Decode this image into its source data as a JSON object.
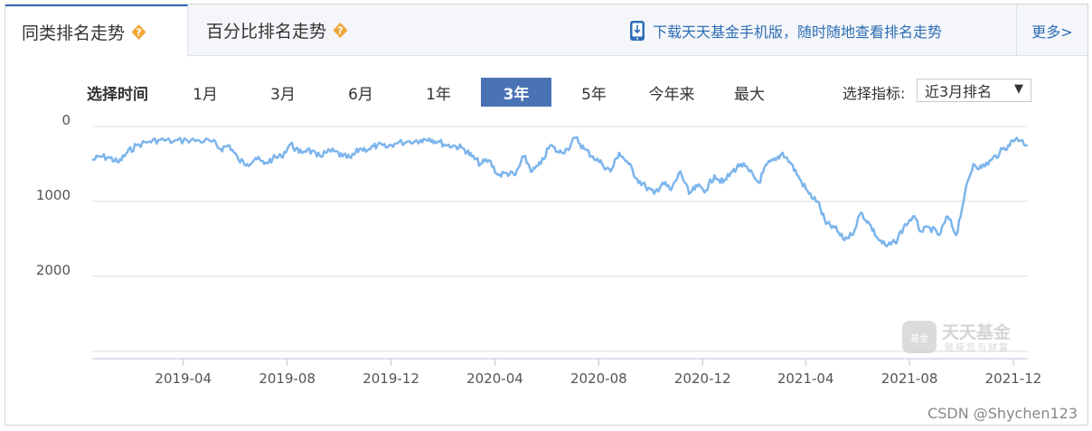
{
  "tabs": [
    {
      "label": "同类排名走势",
      "active": true
    },
    {
      "label": "百分比排名走势",
      "active": false
    }
  ],
  "promo_text": "下载天天基金手机版，随时随地查看排名走势",
  "more_label": "更多>",
  "time_select": {
    "label": "选择时间",
    "options": [
      "1月",
      "3月",
      "6月",
      "1年",
      "3年",
      "5年",
      "今年来",
      "最大"
    ],
    "active": "3年"
  },
  "metric": {
    "label": "选择指标:",
    "selected": "近3月排名"
  },
  "watermark": {
    "name": "天天基金",
    "slogan": "链接您与财富",
    "badge": "基金"
  },
  "credit": "CSDN @Shychen123",
  "colors": {
    "accent": "#4a73b5",
    "line": "#7cb5ec",
    "link": "#2e6db4",
    "icon_orange": "#f0a83a"
  },
  "chart_data": {
    "type": "line",
    "y_reversed": true,
    "ylim": [
      0,
      3100
    ],
    "xlim": [
      "2018-12-15",
      "2021-12-18"
    ],
    "y_ticks": [
      0,
      1000,
      2000
    ],
    "x_ticks": [
      "2019-04",
      "2019-08",
      "2019-12",
      "2020-04",
      "2020-08",
      "2020-12",
      "2021-04",
      "2021-08",
      "2021-12"
    ],
    "grid": true,
    "series": [
      {
        "points": [
          [
            "2018-12-15",
            450
          ],
          [
            "2018-12-25",
            400
          ],
          [
            "2019-01-05",
            420
          ],
          [
            "2019-01-15",
            480
          ],
          [
            "2019-01-25",
            350
          ],
          [
            "2019-02-05",
            250
          ],
          [
            "2019-02-20",
            200
          ],
          [
            "2019-03-05",
            180
          ],
          [
            "2019-03-20",
            200
          ],
          [
            "2019-04-05",
            180
          ],
          [
            "2019-04-20",
            190
          ],
          [
            "2019-05-05",
            200
          ],
          [
            "2019-05-15",
            300
          ],
          [
            "2019-05-25",
            250
          ],
          [
            "2019-06-05",
            450
          ],
          [
            "2019-06-15",
            500
          ],
          [
            "2019-06-25",
            420
          ],
          [
            "2019-07-05",
            500
          ],
          [
            "2019-07-15",
            430
          ],
          [
            "2019-07-25",
            400
          ],
          [
            "2019-08-05",
            230
          ],
          [
            "2019-08-15",
            350
          ],
          [
            "2019-08-25",
            300
          ],
          [
            "2019-09-05",
            400
          ],
          [
            "2019-09-15",
            350
          ],
          [
            "2019-09-25",
            330
          ],
          [
            "2019-10-05",
            400
          ],
          [
            "2019-10-15",
            420
          ],
          [
            "2019-10-25",
            300
          ],
          [
            "2019-11-05",
            300
          ],
          [
            "2019-11-15",
            250
          ],
          [
            "2019-11-25",
            280
          ],
          [
            "2019-12-05",
            230
          ],
          [
            "2019-12-20",
            200
          ],
          [
            "2020-01-05",
            180
          ],
          [
            "2020-01-15",
            160
          ],
          [
            "2020-01-25",
            200
          ],
          [
            "2020-02-05",
            250
          ],
          [
            "2020-02-15",
            260
          ],
          [
            "2020-02-25",
            300
          ],
          [
            "2020-03-05",
            400
          ],
          [
            "2020-03-15",
            500
          ],
          [
            "2020-03-25",
            450
          ],
          [
            "2020-04-05",
            650
          ],
          [
            "2020-04-15",
            620
          ],
          [
            "2020-04-25",
            650
          ],
          [
            "2020-05-05",
            400
          ],
          [
            "2020-05-15",
            600
          ],
          [
            "2020-05-25",
            500
          ],
          [
            "2020-06-05",
            250
          ],
          [
            "2020-06-15",
            350
          ],
          [
            "2020-06-25",
            300
          ],
          [
            "2020-07-05",
            150
          ],
          [
            "2020-07-15",
            300
          ],
          [
            "2020-07-25",
            400
          ],
          [
            "2020-08-05",
            500
          ],
          [
            "2020-08-15",
            600
          ],
          [
            "2020-08-25",
            350
          ],
          [
            "2020-09-05",
            500
          ],
          [
            "2020-09-15",
            700
          ],
          [
            "2020-09-25",
            800
          ],
          [
            "2020-10-05",
            900
          ],
          [
            "2020-10-15",
            750
          ],
          [
            "2020-10-25",
            850
          ],
          [
            "2020-11-05",
            600
          ],
          [
            "2020-11-15",
            900
          ],
          [
            "2020-11-25",
            800
          ],
          [
            "2020-12-05",
            850
          ],
          [
            "2020-12-15",
            650
          ],
          [
            "2020-12-25",
            750
          ],
          [
            "2021-01-05",
            600
          ],
          [
            "2021-01-15",
            500
          ],
          [
            "2021-01-25",
            600
          ],
          [
            "2021-02-05",
            750
          ],
          [
            "2021-02-15",
            500
          ],
          [
            "2021-02-25",
            450
          ],
          [
            "2021-03-05",
            350
          ],
          [
            "2021-03-15",
            500
          ],
          [
            "2021-03-25",
            700
          ],
          [
            "2021-04-05",
            900
          ],
          [
            "2021-04-15",
            1000
          ],
          [
            "2021-04-25",
            1300
          ],
          [
            "2021-05-05",
            1350
          ],
          [
            "2021-05-15",
            1500
          ],
          [
            "2021-05-25",
            1450
          ],
          [
            "2021-06-05",
            1150
          ],
          [
            "2021-06-15",
            1300
          ],
          [
            "2021-06-25",
            1500
          ],
          [
            "2021-07-05",
            1600
          ],
          [
            "2021-07-15",
            1550
          ],
          [
            "2021-07-25",
            1350
          ],
          [
            "2021-08-05",
            1200
          ],
          [
            "2021-08-15",
            1400
          ],
          [
            "2021-08-25",
            1350
          ],
          [
            "2021-09-05",
            1450
          ],
          [
            "2021-09-15",
            1200
          ],
          [
            "2021-09-25",
            1450
          ],
          [
            "2021-10-05",
            900
          ],
          [
            "2021-10-15",
            500
          ],
          [
            "2021-10-25",
            550
          ],
          [
            "2021-11-05",
            450
          ],
          [
            "2021-11-15",
            350
          ],
          [
            "2021-11-25",
            250
          ],
          [
            "2021-12-05",
            150
          ],
          [
            "2021-12-18",
            250
          ]
        ]
      }
    ]
  }
}
